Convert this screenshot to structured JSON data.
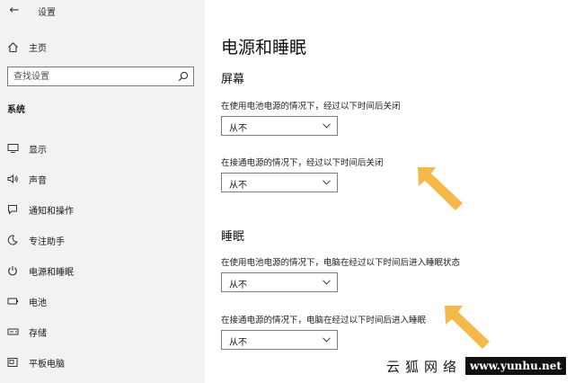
{
  "window": {
    "title": "设置",
    "back_icon": "back-arrow-icon"
  },
  "sidebar": {
    "home_label": "主页",
    "search_placeholder": "查找设置",
    "section_title": "系统",
    "items": [
      {
        "label": "显示",
        "icon": "monitor-icon"
      },
      {
        "label": "声音",
        "icon": "speaker-icon"
      },
      {
        "label": "通知和操作",
        "icon": "notification-icon"
      },
      {
        "label": "专注助手",
        "icon": "moon-icon"
      },
      {
        "label": "电源和睡眠",
        "icon": "power-icon"
      },
      {
        "label": "电池",
        "icon": "battery-icon"
      },
      {
        "label": "存储",
        "icon": "storage-icon"
      },
      {
        "label": "平板电脑",
        "icon": "tablet-icon"
      }
    ]
  },
  "main": {
    "title": "电源和睡眠",
    "screen": {
      "title": "屏幕",
      "battery_label": "在使用电池电源的情况下，经过以下时间后关闭",
      "battery_value": "从不",
      "plugged_label": "在接通电源的情况下，经过以下时间后关闭",
      "plugged_value": "从不"
    },
    "sleep": {
      "title": "睡眠",
      "battery_label": "在使用电池电源的情况下，电脑在经过以下时间后进入睡眠状态",
      "battery_value": "从不",
      "plugged_label": "在接通电源的情况下，电脑在经过以下时间后进入睡眠",
      "plugged_value": "从不"
    }
  },
  "annotation": {
    "arrow_color": "#f5b94a"
  },
  "watermark": {
    "text": "云狐网络",
    "url": "www.yunhu.net"
  }
}
